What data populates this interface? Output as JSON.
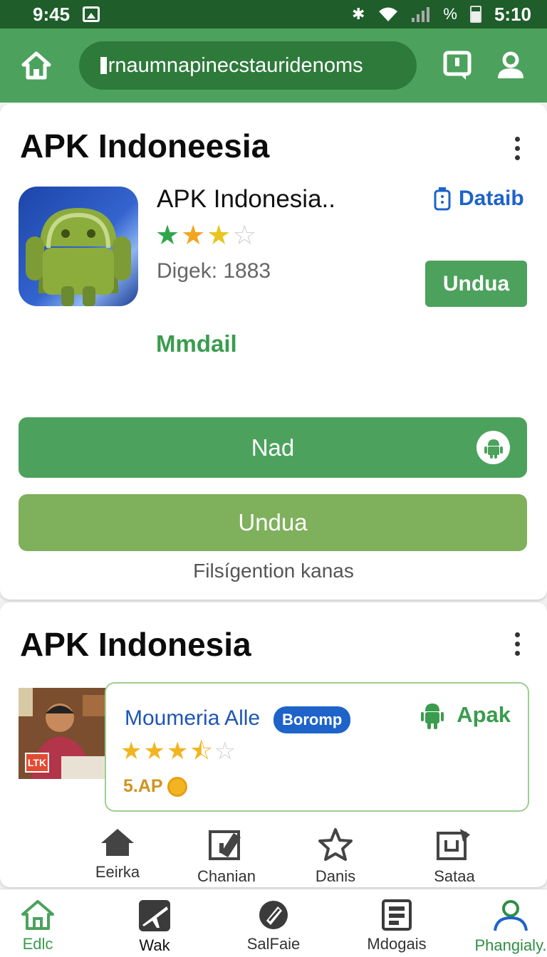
{
  "status_bar": {
    "time_left": "9:45",
    "time_right": "5:10",
    "icons": [
      "image-icon",
      "bluetooth-icon",
      "wifi-icon",
      "signal-icon",
      "battery-icon"
    ],
    "signal_text": "%"
  },
  "app_bar": {
    "url": "rnaumnapinecstauridenoms",
    "icons": [
      "home-icon",
      "chat-icon",
      "profile-icon"
    ],
    "color": "#4ca25c"
  },
  "card1": {
    "title": "APK Indoneesia",
    "app": {
      "name": "APK Indonesia..",
      "rating": 3,
      "rating_max": 5,
      "downloads": "Digek: 1883",
      "detail_label": "Dataib",
      "download_label": "Undua",
      "more_label": "Mmdail"
    },
    "primary_button": "Nad",
    "secondary_button": "Undua",
    "footnote": "Filsígention kanas"
  },
  "card2": {
    "title": "APK Indonesia",
    "photo_badge": "LTK",
    "item": {
      "name": "Moumeria Alle",
      "tag": "Boromp",
      "action": "Apak",
      "rating": 3.5,
      "rating_max": 5,
      "score": "5.AP"
    },
    "quick_actions": [
      {
        "label": "Eeirka",
        "icon": "home-icon"
      },
      {
        "label": "Chanian",
        "icon": "edit-icon"
      },
      {
        "label": "Danis",
        "icon": "star-icon"
      },
      {
        "label": "Sataa",
        "icon": "share-icon"
      }
    ]
  },
  "bottom_nav": [
    {
      "label": "Edlc",
      "icon": "home-icon",
      "active": false
    },
    {
      "label": "Wak",
      "icon": "plane-icon",
      "active": false
    },
    {
      "label": "SalFaie",
      "icon": "tag-icon",
      "active": false
    },
    {
      "label": "Mdogais",
      "icon": "document-icon",
      "active": false
    },
    {
      "label": "Phangialy.",
      "icon": "profile-icon",
      "active": true
    }
  ],
  "colors": {
    "primary_green": "#4ca25c",
    "light_green": "#7fb05b",
    "dark_green": "#1f5d2b",
    "link_blue": "#1d63c9",
    "star_gold": "#f2b522",
    "star_green": "#2fa64a"
  }
}
